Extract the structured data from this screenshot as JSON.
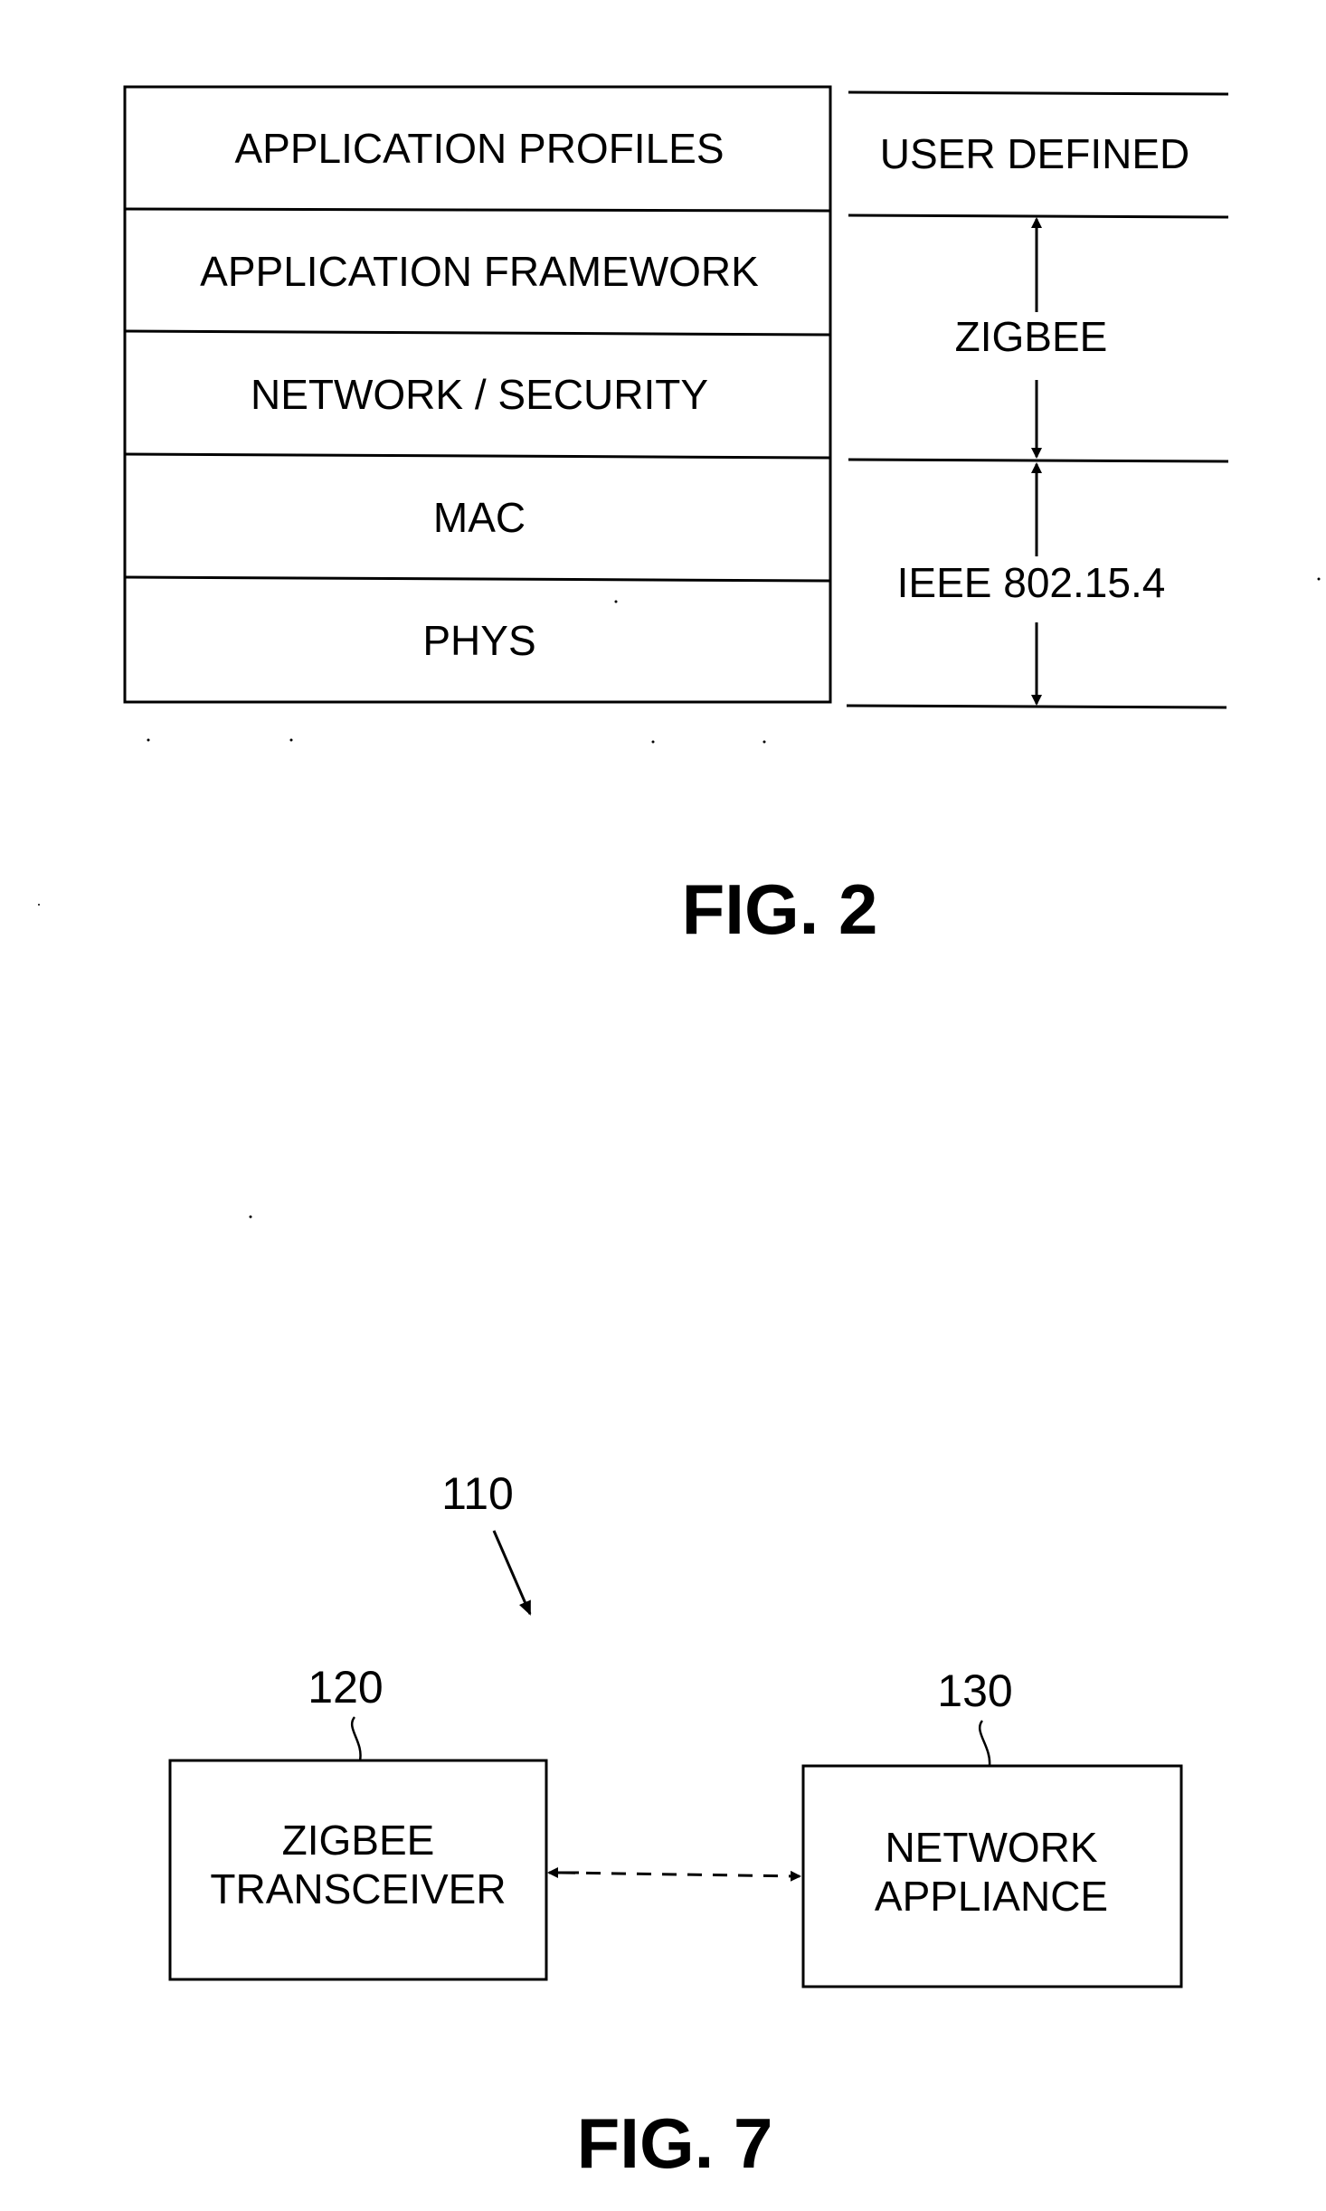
{
  "fig2": {
    "caption": "FIG. 2",
    "layers": [
      {
        "label": "APPLICATION PROFILES"
      },
      {
        "label": "APPLICATION FRAMEWORK"
      },
      {
        "label": "NETWORK / SECURITY"
      },
      {
        "label": "MAC"
      },
      {
        "label": "PHYS"
      }
    ],
    "groups": [
      {
        "label": "USER DEFINED",
        "spans_layers": [
          "APPLICATION PROFILES"
        ],
        "arrow": false
      },
      {
        "label": "ZIGBEE",
        "spans_layers": [
          "APPLICATION FRAMEWORK",
          "NETWORK / SECURITY"
        ],
        "arrow": true
      },
      {
        "label": "IEEE 802.15.4",
        "spans_layers": [
          "MAC",
          "PHYS"
        ],
        "arrow": true
      }
    ]
  },
  "fig7": {
    "caption": "FIG. 7",
    "system_ref": "110",
    "blocks": [
      {
        "ref": "120",
        "line1": "ZIGBEE",
        "line2": "TRANSCEIVER"
      },
      {
        "ref": "130",
        "line1": "NETWORK",
        "line2": "APPLIANCE"
      }
    ],
    "connection": {
      "style": "dashed",
      "direction": "bidirectional",
      "from": "120",
      "to": "130"
    }
  }
}
